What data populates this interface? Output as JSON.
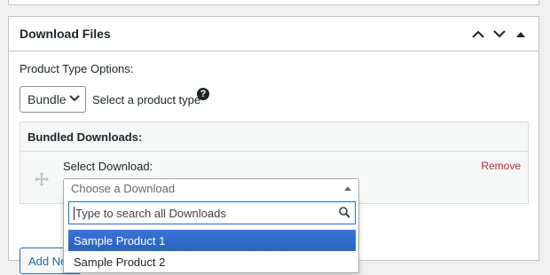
{
  "metabox": {
    "title": "Download Files",
    "controls": [
      "move-up-icon",
      "move-down-icon",
      "toggle-panel-icon"
    ]
  },
  "product_type": {
    "label": "Product Type Options:",
    "selected": "Bundle",
    "hint": "Select a product type",
    "help_glyph": "?"
  },
  "bundled": {
    "header": "Bundled Downloads:",
    "row": {
      "select_label": "Select Download:",
      "remove_label": "Remove"
    }
  },
  "add_button_label": "Add New Download",
  "dropdown": {
    "placeholder": "Choose a Download",
    "search_placeholder": "Type to search all Downloads",
    "options": [
      "Sample Product 1",
      "Sample Product 2"
    ],
    "highlighted_index": 0
  },
  "colors": {
    "accent": "#2271b1",
    "highlight": "#3875d7",
    "remove": "#b32d2e",
    "border": "#c3c4c7"
  }
}
